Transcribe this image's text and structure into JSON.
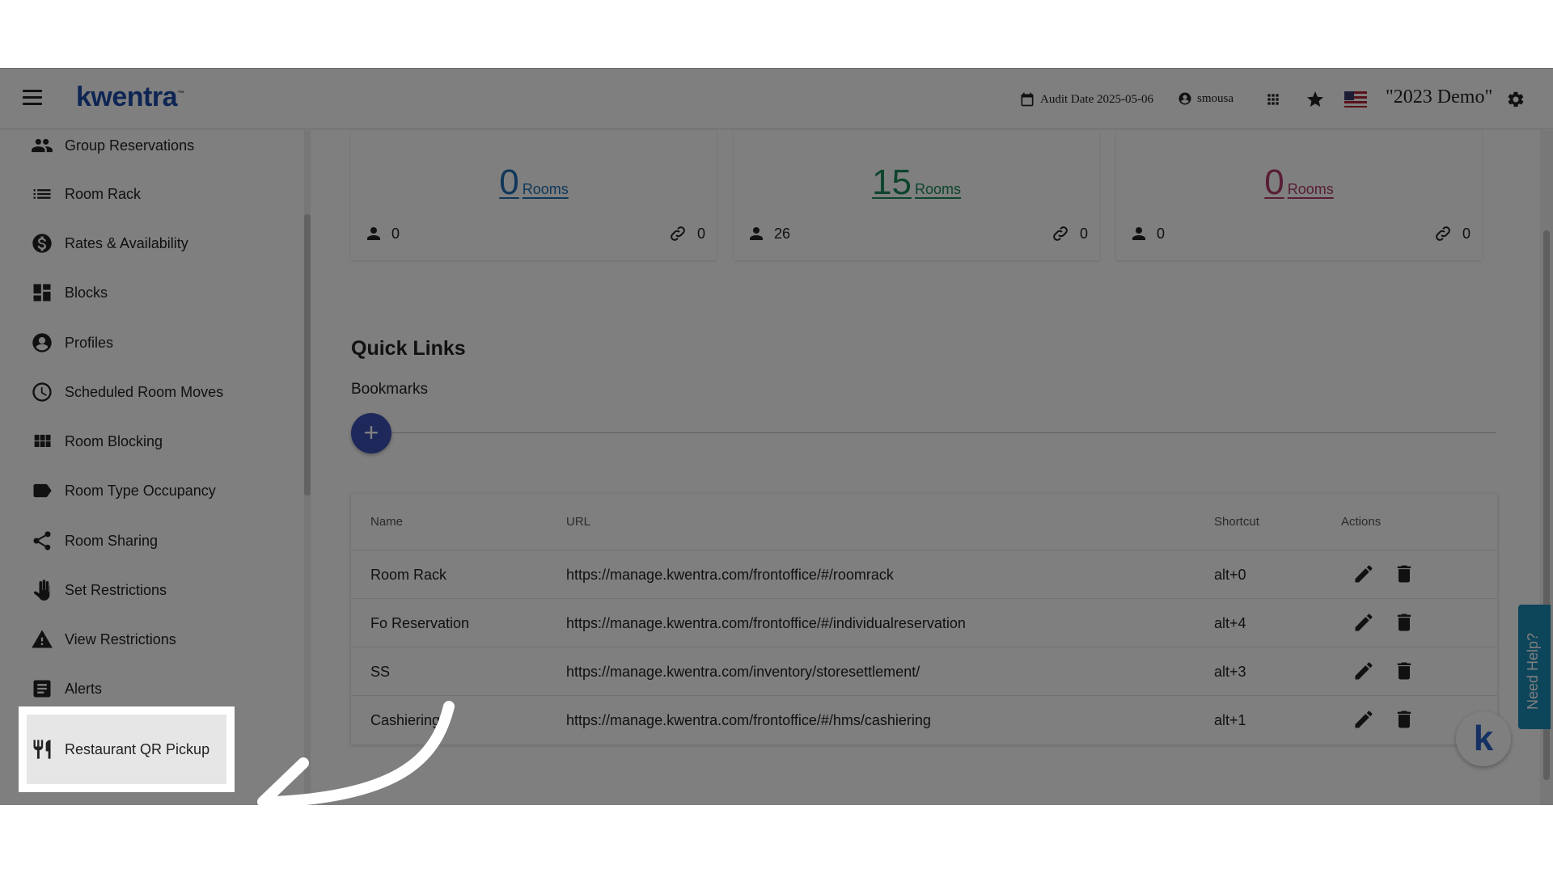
{
  "app": {
    "logo": "kwentra",
    "audit_label": "Audit Date 2025-05-06",
    "user": "smousa",
    "demo_title": "\"2023 Demo\""
  },
  "sidebar": {
    "items": [
      {
        "label": "Group Reservations",
        "icon": "group-icon"
      },
      {
        "label": "Room Rack",
        "icon": "list-icon"
      },
      {
        "label": "Rates & Availability",
        "icon": "dollar-icon"
      },
      {
        "label": "Blocks",
        "icon": "dashboard-icon"
      },
      {
        "label": "Profiles",
        "icon": "account-icon"
      },
      {
        "label": "Scheduled Room Moves",
        "icon": "clock-icon"
      },
      {
        "label": "Room Blocking",
        "icon": "grid-icon"
      },
      {
        "label": "Room Type Occupancy",
        "icon": "tag-icon"
      },
      {
        "label": "Room Sharing",
        "icon": "share-icon"
      },
      {
        "label": "Set Restrictions",
        "icon": "hand-icon"
      },
      {
        "label": "View Restrictions",
        "icon": "warning-icon"
      },
      {
        "label": "Alerts",
        "icon": "note-icon"
      }
    ],
    "highlighted": {
      "label": "Restaurant QR Pickup",
      "icon": "fork-knife-icon"
    }
  },
  "stats": [
    {
      "value": "0",
      "unit": "Rooms",
      "color": "#1f6fb2",
      "persons": "0",
      "links": "0"
    },
    {
      "value": "15",
      "unit": "Rooms",
      "color": "#1a8a5a",
      "persons": "26",
      "links": "0"
    },
    {
      "value": "0",
      "unit": "Rooms",
      "color": "#b03a6a",
      "persons": "0",
      "links": "0"
    }
  ],
  "quick_links": {
    "title": "Quick Links",
    "bookmarks_label": "Bookmarks",
    "add_label": "+",
    "columns": [
      "Name",
      "URL",
      "Shortcut",
      "Actions"
    ],
    "rows": [
      {
        "name": "Room Rack",
        "url": "https://manage.kwentra.com/frontoffice/#/roomrack",
        "shortcut": "alt+0"
      },
      {
        "name": "Fo Reservation",
        "url": "https://manage.kwentra.com/frontoffice/#/individualreservation",
        "shortcut": "alt+4"
      },
      {
        "name": "SS",
        "url": "https://manage.kwentra.com/inventory/storesettlement/",
        "shortcut": "alt+3"
      },
      {
        "name": "Cashiering",
        "url": "https://manage.kwentra.com/frontoffice/#/hms/cashiering",
        "shortcut": "alt+1"
      }
    ]
  },
  "widgets": {
    "need_help": "Need Help?",
    "badge": "k"
  }
}
